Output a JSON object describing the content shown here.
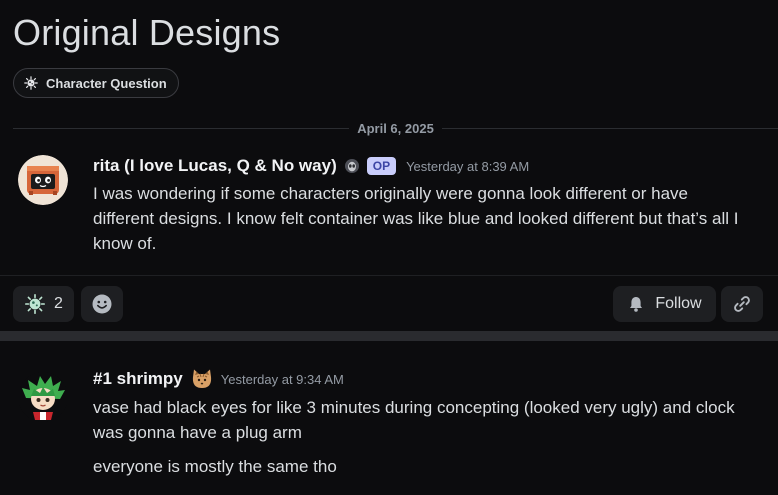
{
  "post": {
    "title": "Original Designs",
    "tag": {
      "label": "Character Question",
      "icon": "bacteria-icon"
    },
    "date_divider": "April 6, 2025"
  },
  "op_message": {
    "author": "rita (I love Lucas, Q & No way)",
    "status_icon": "alien-icon",
    "badge": "OP",
    "timestamp": "Yesterday at 8:39 AM",
    "text": "I was wondering if some characters originally were gonna look different or have different designs. I know felt container was like blue and looked different but that’s all I know of."
  },
  "actions": {
    "reaction_icon": "bacteria-icon",
    "reaction_count": "2",
    "add_reaction_icon": "smiley-icon",
    "follow_label": "Follow",
    "follow_icon": "bell-icon",
    "copy_link_icon": "link-icon"
  },
  "reply": {
    "author": "#1 shrimpy",
    "badge_icon": "cat-icon",
    "timestamp": "Yesterday at 9:34 AM",
    "lines": [
      "vase had black eyes for like 3 minutes during concepting (looked very ugly) and clock was gonna have a plug arm",
      "everyone is mostly the same tho"
    ]
  },
  "colors": {
    "background": "#0c0c0e",
    "op_badge_bg": "#c9cdfb",
    "op_badge_text": "#3c45a5",
    "button_bg": "#1e1f22",
    "muted_text": "#949ba4"
  }
}
